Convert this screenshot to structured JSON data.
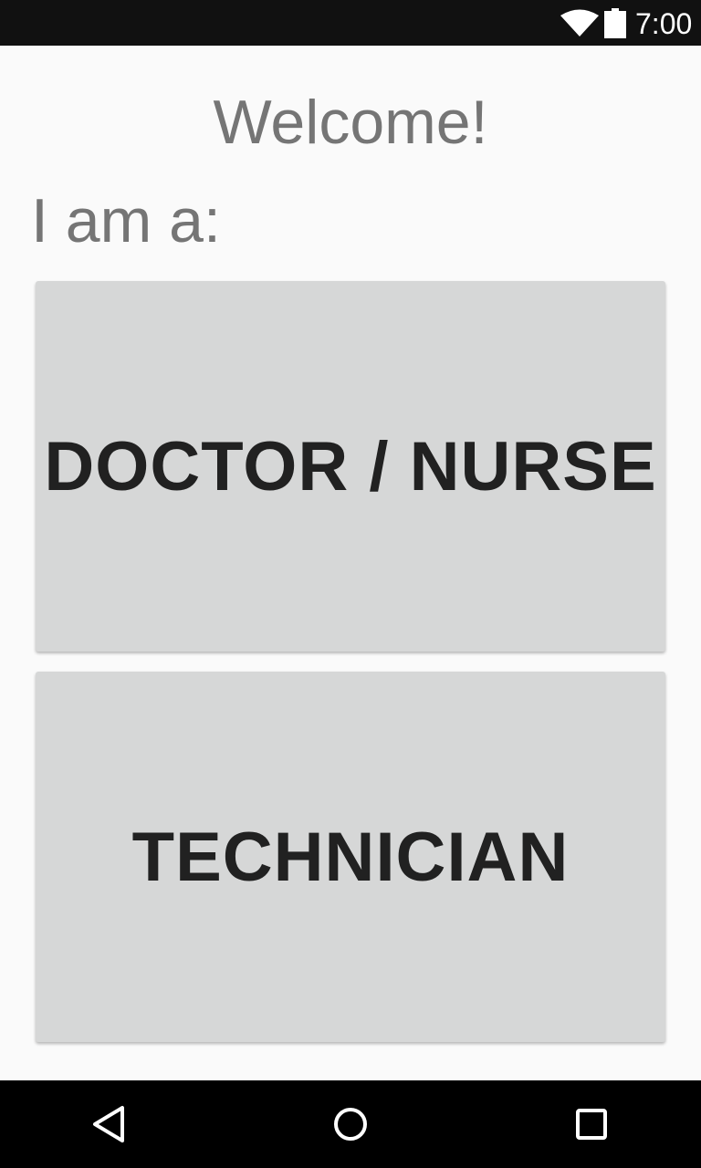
{
  "status_bar": {
    "time": "7:00",
    "icons": [
      "wifi-icon",
      "battery-icon"
    ]
  },
  "main": {
    "title": "Welcome!",
    "prompt": "I am a:",
    "buttons": [
      {
        "label": "DOCTOR / NURSE"
      },
      {
        "label": "TECHNICIAN"
      }
    ]
  },
  "nav_bar": {
    "icons": [
      "back-icon",
      "home-icon",
      "recents-icon"
    ]
  },
  "colors": {
    "status_bar_bg": "#111111",
    "background": "#fafafa",
    "muted_text": "#757575",
    "button_bg": "#d6d7d7",
    "button_text": "#212121",
    "nav_bar_bg": "#000000"
  }
}
